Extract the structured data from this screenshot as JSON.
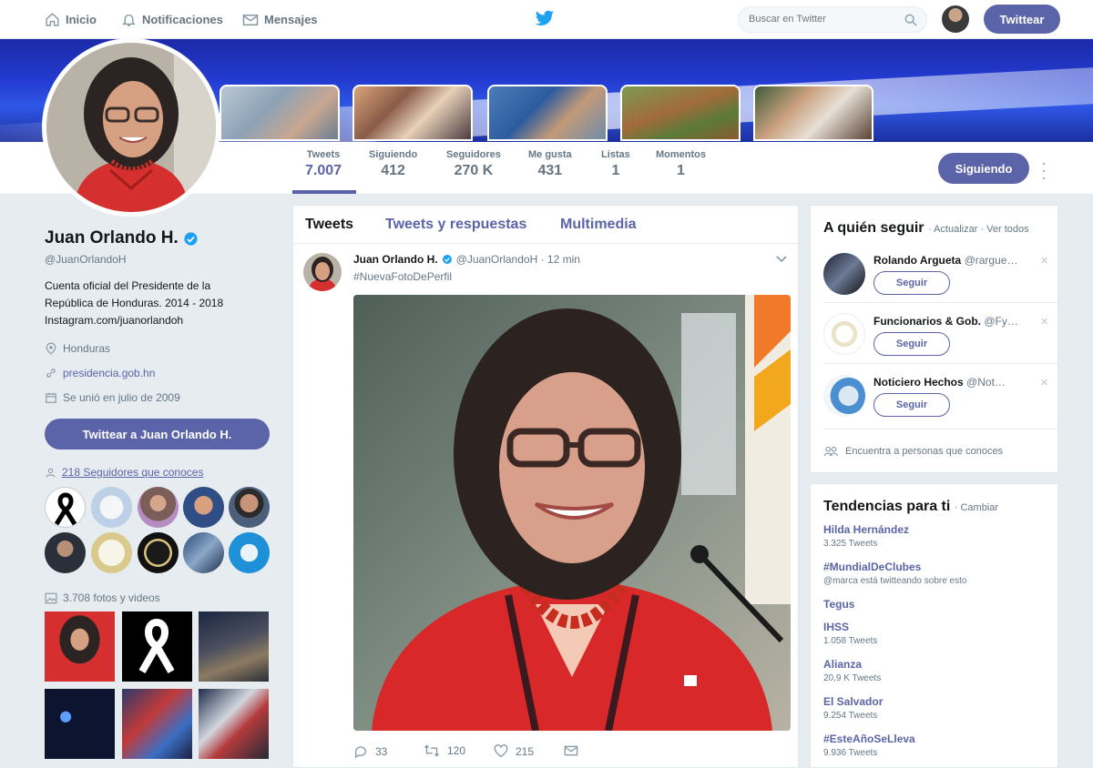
{
  "nav": {
    "home": "Inicio",
    "notifications": "Notificaciones",
    "messages": "Mensajes",
    "search_placeholder": "Buscar en Twitter",
    "tweet_button": "Twittear"
  },
  "profile": {
    "name": "Juan Orlando H.",
    "handle": "@JuanOrlandoH",
    "bio_lines": [
      "Cuenta oficial del Presidente de la",
      "República de Honduras. 2014 - 2018",
      "Instagram.com/juanorlandoh"
    ],
    "location": "Honduras",
    "website": "presidencia.gob.hn",
    "joined": "Se unió en julio de 2009",
    "tweet_to_button": "Twittear a Juan Orlando H.",
    "followers_you_know": "218 Seguidores que conoces",
    "photos_videos": "3.708 fotos y videos"
  },
  "stats": [
    {
      "label": "Tweets",
      "value": "7.007"
    },
    {
      "label": "Siguiendo",
      "value": "412"
    },
    {
      "label": "Seguidores",
      "value": "270 K"
    },
    {
      "label": "Me gusta",
      "value": "431"
    },
    {
      "label": "Listas",
      "value": "1"
    },
    {
      "label": "Momentos",
      "value": "1"
    }
  ],
  "follow_state_button": "Siguiendo",
  "timeline": {
    "tabs": [
      "Tweets",
      "Tweets y respuestas",
      "Multimedia"
    ],
    "tweet": {
      "name": "Juan Orlando H.",
      "handle_time": "@JuanOrlandoH · 12 min",
      "text": "#NuevaFotoDePerfil",
      "replies": "33",
      "retweets": "120",
      "likes": "215"
    }
  },
  "who_to_follow": {
    "title": "A quién seguir",
    "links": "· Actualizar · Ver todos",
    "accounts": [
      {
        "name": "Rolando Argueta",
        "handle": "@rargue…"
      },
      {
        "name": "Funcionarios & Gob.",
        "handle": "@Fy…"
      },
      {
        "name": "Noticiero Hechos",
        "handle": "@Not…"
      }
    ],
    "follow_label": "Seguir",
    "find_people": "Encuentra a personas que conoces"
  },
  "trends": {
    "title": "Tendencias para ti",
    "change": "· Cambiar",
    "items": [
      {
        "topic": "Hilda Hernández",
        "count": "3.325 Tweets"
      },
      {
        "topic": "#MundialDeClubes",
        "count": "@marca está twitteando sobre esto"
      },
      {
        "topic": "Tegus",
        "count": ""
      },
      {
        "topic": "IHSS",
        "count": "1.058 Tweets"
      },
      {
        "topic": "Alianza",
        "count": "20,9 K Tweets"
      },
      {
        "topic": "El Salvador",
        "count": "9.254 Tweets"
      },
      {
        "topic": "#EsteAñoSeLleva",
        "count": "9.936 Tweets"
      }
    ]
  },
  "colors": {
    "accent": "#5b64a8",
    "banner": "#233bd0"
  }
}
